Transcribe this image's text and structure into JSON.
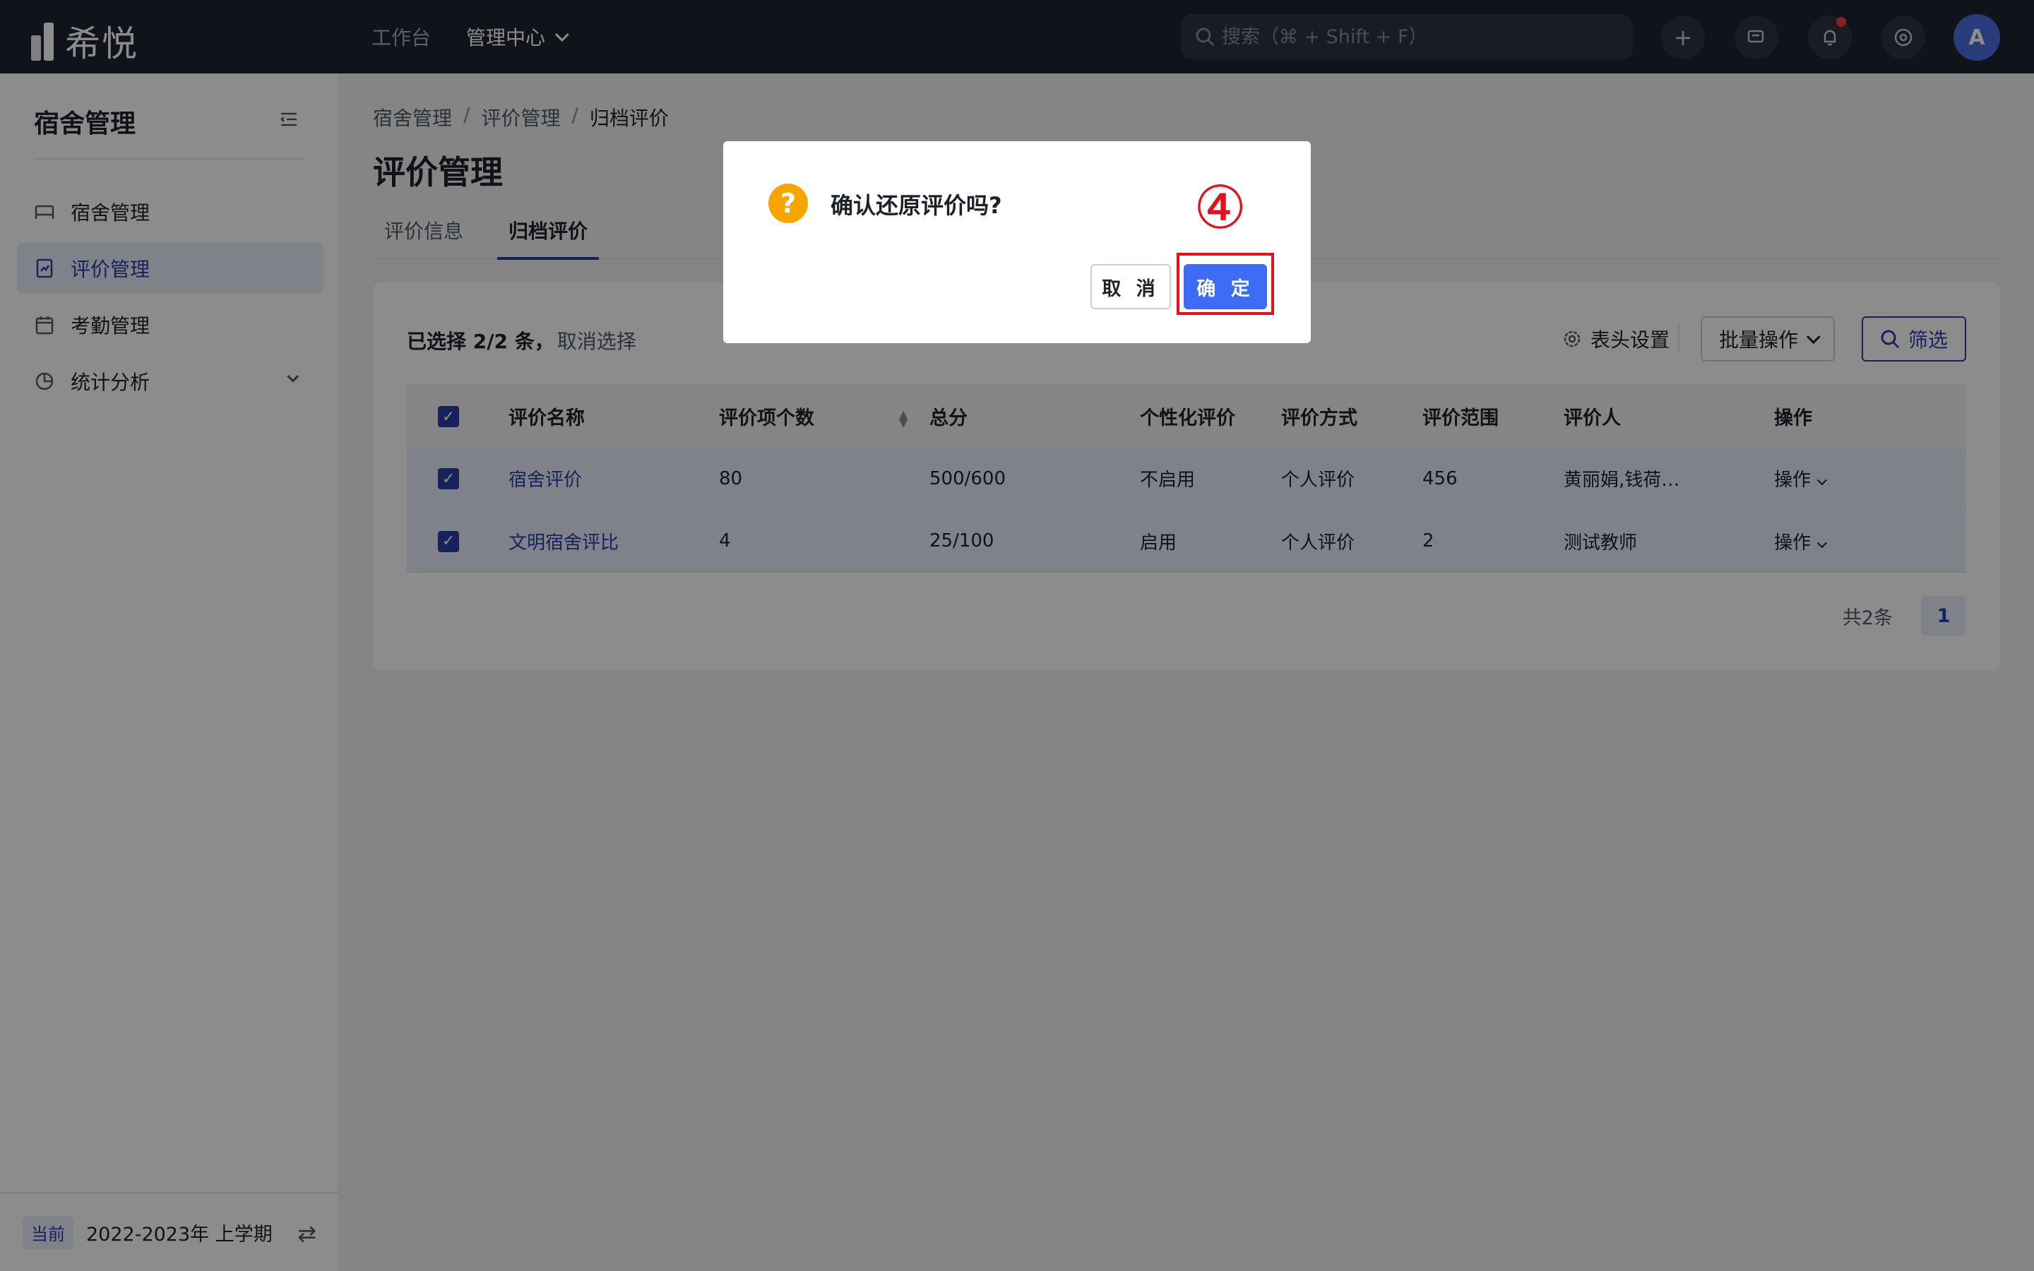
{
  "app": {
    "logo_text": "希悦"
  },
  "topnav": {
    "items": [
      {
        "label": "工作台"
      },
      {
        "label": "管理中心"
      }
    ]
  },
  "search": {
    "placeholder": "搜索（⌘ + Shift + F）"
  },
  "topbar_icons": [
    "plus-icon",
    "message-icon",
    "bell-icon",
    "settings-icon"
  ],
  "user": {
    "avatar": "A"
  },
  "sidebar": {
    "title": "宿舍管理",
    "items": [
      {
        "label": "宿舍管理",
        "icon": "bed-icon"
      },
      {
        "label": "评价管理",
        "icon": "evaluation-icon"
      },
      {
        "label": "考勤管理",
        "icon": "calendar-icon"
      },
      {
        "label": "统计分析",
        "icon": "pie-chart-icon"
      }
    ],
    "footer": {
      "badge": "当前",
      "term": "2022-2023年 上学期"
    }
  },
  "breadcrumb": [
    "宿舍管理",
    "评价管理",
    "归档评价"
  ],
  "breadcrumb_sep": "/",
  "page": {
    "title": "评价管理"
  },
  "tabs": [
    {
      "label": "评价信息"
    },
    {
      "label": "归档评价"
    }
  ],
  "selection": {
    "text": "已选择 2/2 条，",
    "cancel": "取消选择"
  },
  "toolbar": {
    "settings": "表头设置",
    "batch": "批量操作",
    "filter": "筛选"
  },
  "table": {
    "headers": [
      "评价名称",
      "评价项个数",
      "总分",
      "个性化评价",
      "评价方式",
      "评价范围",
      "评价人",
      "操作"
    ],
    "rows": [
      {
        "name": "宿舍评价",
        "count": "80",
        "score": "500/600",
        "personal": "不启用",
        "method": "个人评价",
        "scope": "456",
        "evaluator": "黄丽娟,钱荷…",
        "action": "操作"
      },
      {
        "name": "文明宿舍评比",
        "count": "4",
        "score": "25/100",
        "personal": "启用",
        "method": "个人评价",
        "scope": "2",
        "evaluator": "测试教师",
        "action": "操作"
      }
    ]
  },
  "pagination": {
    "total": "共2条",
    "current": "1"
  },
  "dialog": {
    "title": "确认还原评价吗?",
    "cancel": "取 消",
    "ok": "确 定"
  },
  "annotation": {
    "step": "④"
  },
  "colors": {
    "primary": "#2a3fa8",
    "ok_button": "#3f6cf5",
    "warning": "#f7a600",
    "annotation": "#e5121a",
    "topbar": "#1f2330"
  }
}
